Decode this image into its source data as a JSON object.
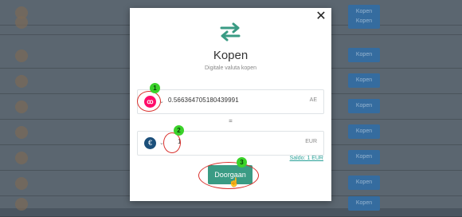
{
  "modal": {
    "title": "Kopen",
    "subtitle": "Digitale valuta kopen",
    "close_glyph": "✕",
    "from": {
      "coin_icon": "aeternity-coin-icon",
      "coin_color": "#ff0d6a",
      "amount": "0.566364705180439991",
      "unit": "AE"
    },
    "equals": "=",
    "to": {
      "coin_icon": "euro-coin-icon",
      "coin_glyph": "€",
      "amount": "1",
      "unit": "EUR"
    },
    "balance_link": "Saldo: 1 EUR",
    "continue_button": "Doorgaan",
    "accent_color": "#3a9b84"
  },
  "annotations": {
    "badges": [
      "1",
      "2",
      "3"
    ],
    "ellipse_color": "#d9302c",
    "badge_color": "#3bd22a"
  },
  "background_buy_button": "Kopen"
}
